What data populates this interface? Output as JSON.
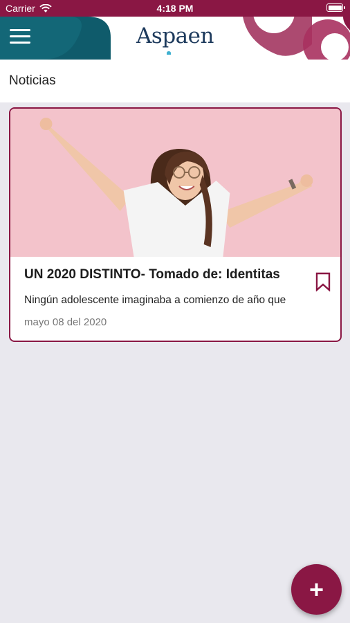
{
  "status_bar": {
    "carrier": "Carrier",
    "time": "4:18 PM"
  },
  "header": {
    "logo_text": "Aspaen",
    "menu_icon": "hamburger-menu-icon"
  },
  "section": {
    "title": "Noticias"
  },
  "news": [
    {
      "title": "UN 2020 DISTINTO- Tomado de: Identitas",
      "excerpt": "Ningún adolescente imaginaba a comienzo de año que",
      "date": "mayo 08 del 2020",
      "bookmark_icon": "bookmark-icon"
    }
  ],
  "fab": {
    "label": "+",
    "icon": "plus-icon"
  },
  "colors": {
    "brand": "#8a1744",
    "teal": "#0f5b6b",
    "background": "#e9e8ee",
    "photo_background": "#f3c3cb"
  }
}
